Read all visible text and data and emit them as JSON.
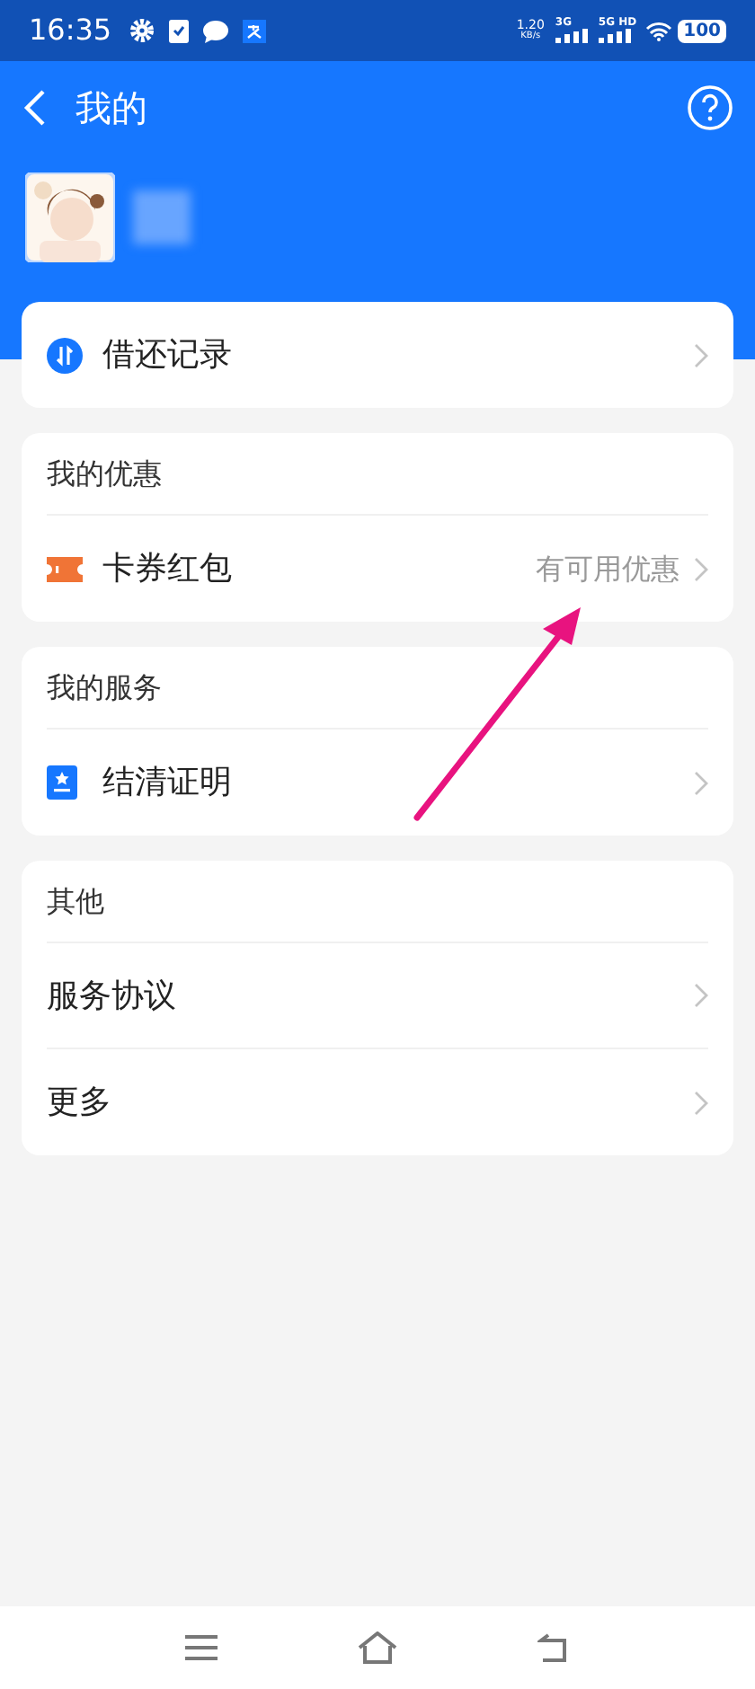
{
  "status_bar": {
    "time": "16:35",
    "net_speed": "1.20",
    "net_unit": "KB/s",
    "signal_1": "3G",
    "signal_2": "5G HD",
    "battery": "100"
  },
  "header": {
    "title": "我的"
  },
  "sections": [
    {
      "items": [
        {
          "kind": "swap",
          "label": "借还记录"
        }
      ]
    },
    {
      "title": "我的优惠",
      "items": [
        {
          "kind": "ticket",
          "label": "卡券红包",
          "value": "有可用优惠"
        }
      ]
    },
    {
      "title": "我的服务",
      "items": [
        {
          "kind": "certificate",
          "label": "结清证明"
        }
      ]
    },
    {
      "title": "其他",
      "items": [
        {
          "label": "服务协议"
        },
        {
          "label": "更多"
        }
      ]
    }
  ],
  "annotation": {
    "kind": "arrow"
  }
}
